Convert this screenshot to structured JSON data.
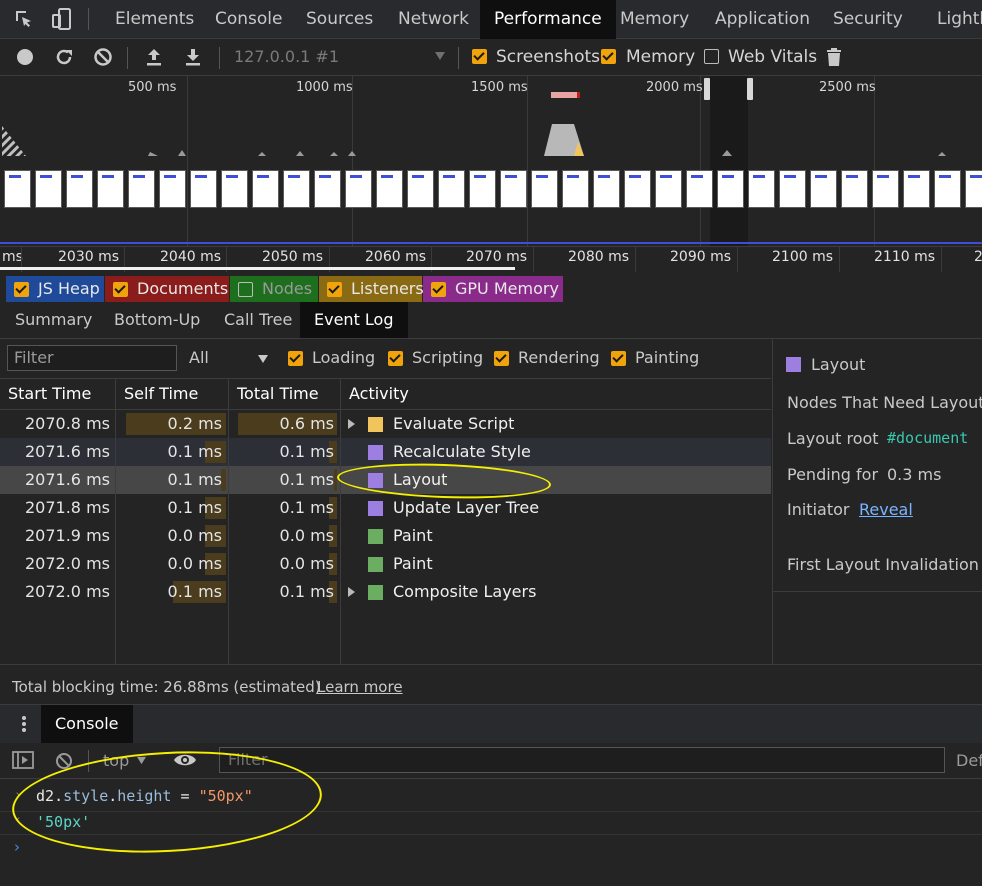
{
  "tabs": {
    "items": [
      "Elements",
      "Console",
      "Sources",
      "Network",
      "Performance",
      "Memory",
      "Application",
      "Security",
      "Lighthouse"
    ],
    "active": "Performance"
  },
  "toolbar": {
    "target": "127.0.0.1 #1",
    "screenshots_label": "Screenshots",
    "screenshots_checked": true,
    "memory_label": "Memory",
    "memory_checked": true,
    "web_vitals_label": "Web Vitals",
    "web_vitals_checked": false
  },
  "overview": {
    "labels": [
      "500 ms",
      "1000 ms",
      "1500 ms",
      "2000 ms",
      "2500 ms"
    ]
  },
  "ruler": {
    "labels": [
      "ms",
      "2030 ms",
      "2040 ms",
      "2050 ms",
      "2060 ms",
      "2070 ms",
      "2080 ms",
      "2090 ms",
      "2100 ms",
      "2110 ms",
      "2"
    ]
  },
  "counters": [
    {
      "label": "JS Heap",
      "checked": true,
      "color": "#1f4a9a"
    },
    {
      "label": "Documents",
      "checked": true,
      "color": "#8a1c1c"
    },
    {
      "label": "Nodes",
      "checked": false,
      "color": "#1d6e1d"
    },
    {
      "label": "Listeners",
      "checked": true,
      "color": "#8a6a12"
    },
    {
      "label": "GPU Memory",
      "checked": true,
      "color": "#8a2a8a"
    }
  ],
  "subtabs": {
    "items": [
      "Summary",
      "Bottom-Up",
      "Call Tree",
      "Event Log"
    ],
    "active": "Event Log"
  },
  "filter": {
    "placeholder": "Filter",
    "select_value": "All",
    "loading_label": "Loading",
    "scripting_label": "Scripting",
    "rendering_label": "Rendering",
    "painting_label": "Painting"
  },
  "table": {
    "headers": [
      "Start Time",
      "Self Time",
      "Total Time",
      "Activity"
    ],
    "rows": [
      {
        "start": "2070.8 ms",
        "self": "0.2 ms",
        "total": "0.6 ms",
        "activity": "Evaluate Script",
        "color": "#f2c55c",
        "expandable": true,
        "self_fill": 0.95,
        "total_fill": 0.95
      },
      {
        "start": "2071.6 ms",
        "self": "0.1 ms",
        "total": "0.1 ms",
        "activity": "Recalculate Style",
        "color": "#9c7fe0",
        "expandable": false,
        "self_fill": 0.2,
        "total_fill": 0.08
      },
      {
        "start": "2071.6 ms",
        "self": "0.1 ms",
        "total": "0.1 ms",
        "activity": "Layout",
        "color": "#9c7fe0",
        "expandable": false,
        "self_fill": 0.05,
        "total_fill": 0.03
      },
      {
        "start": "2071.8 ms",
        "self": "0.1 ms",
        "total": "0.1 ms",
        "activity": "Update Layer Tree",
        "color": "#9c7fe0",
        "expandable": false,
        "self_fill": 0.2,
        "total_fill": 0.08
      },
      {
        "start": "2071.9 ms",
        "self": "0.0 ms",
        "total": "0.0 ms",
        "activity": "Paint",
        "color": "#6cae61",
        "expandable": false,
        "self_fill": 0.2,
        "total_fill": 0.08
      },
      {
        "start": "2072.0 ms",
        "self": "0.0 ms",
        "total": "0.0 ms",
        "activity": "Paint",
        "color": "#6cae61",
        "expandable": false,
        "self_fill": 0.2,
        "total_fill": 0.08
      },
      {
        "start": "2072.0 ms",
        "self": "0.1 ms",
        "total": "0.1 ms",
        "activity": "Composite Layers",
        "color": "#6cae61",
        "expandable": true,
        "self_fill": 0.5,
        "total_fill": 0.08
      }
    ],
    "selected_index": 2
  },
  "details": {
    "title": "Layout",
    "title_color": "#9c7fe0",
    "nodes_label": "Nodes That Need Layout",
    "layout_root_label": "Layout root",
    "layout_root_value": "#document",
    "pending_label": "Pending for",
    "pending_value": "0.3 ms",
    "initiator_label": "Initiator",
    "initiator_link": "Reveal",
    "first_invalidation_label": "First Layout Invalidation"
  },
  "footer": {
    "text": "Total blocking time: 26.88ms (estimated)",
    "link": "Learn more"
  },
  "drawer": {
    "tab": "Console",
    "context": "top",
    "filter_placeholder": "Filter",
    "levels_label": "Def"
  },
  "console": {
    "input": {
      "object": "d2",
      "dot1": ".",
      "prop1": "style",
      "dot2": ".",
      "prop2": "height",
      "op": " = ",
      "string": "\"50px\""
    },
    "output": "'50px'"
  }
}
